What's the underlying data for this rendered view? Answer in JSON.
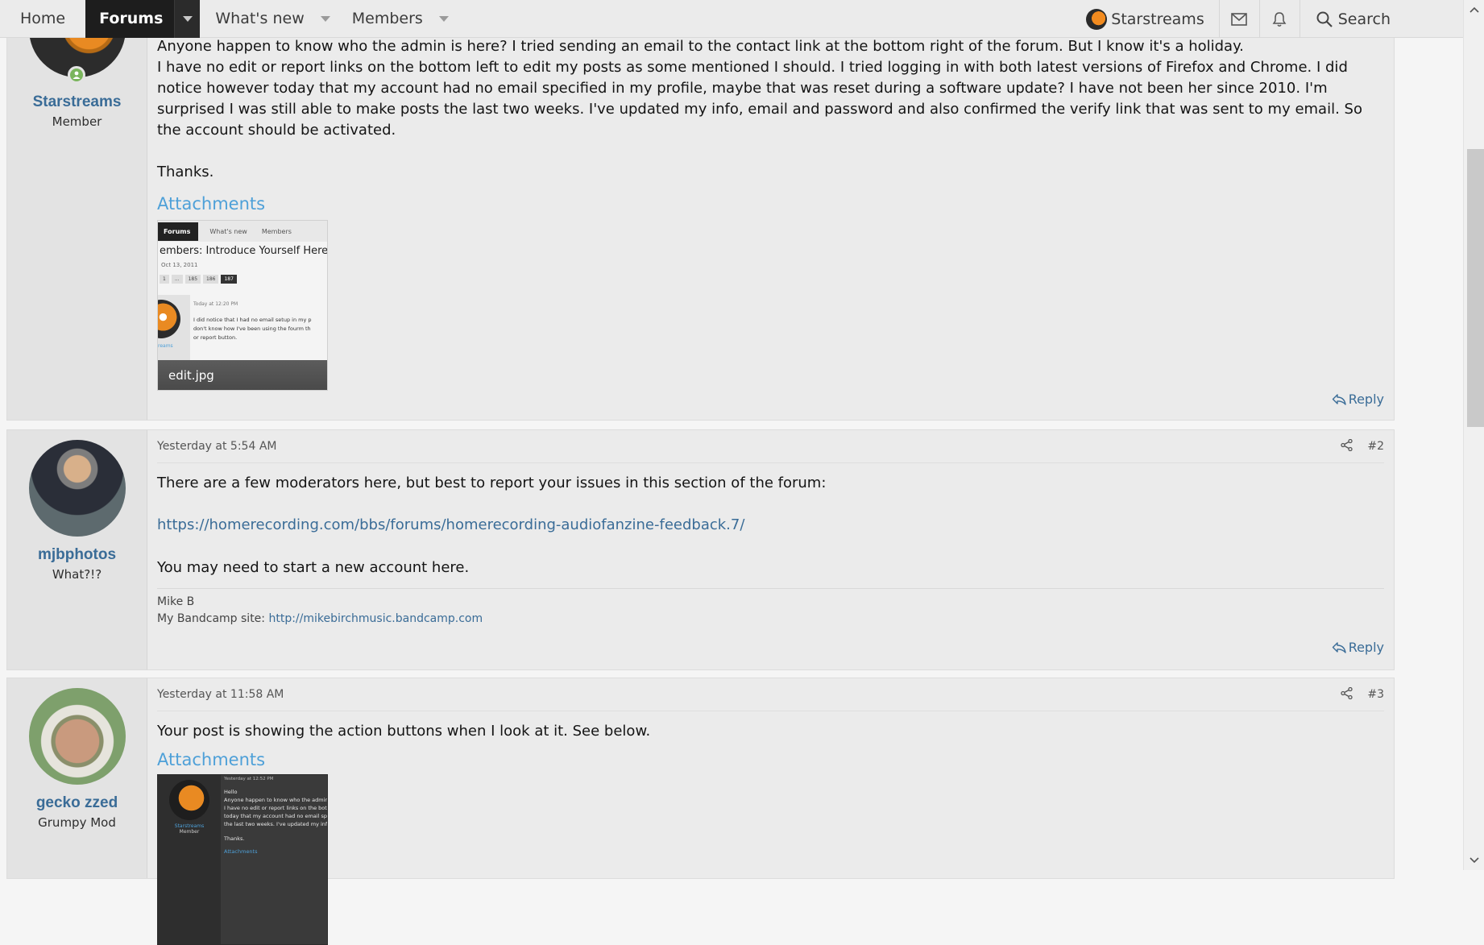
{
  "nav": {
    "home": "Home",
    "forums": "Forums",
    "whats_new": "What's new",
    "members": "Members",
    "user": "Starstreams",
    "search": "Search"
  },
  "posts": [
    {
      "username": "Starstreams",
      "user_title": "Member",
      "online": true,
      "paragraphs": [
        "Anyone happen to know who the admin is here? I tried sending an email to the contact link at the bottom right of the forum. But I know it's a holiday.",
        "I have no edit or report links on the bottom left to edit my posts as some mentioned I should. I tried logging in with both latest versions of Firefox and Chrome. I did notice however today that my account had no email specified in my profile, maybe that was reset during a software update? I have not been her since 2010. I'm surprised I was still able to make posts the last two weeks. I've updated my info, email and password and also confirmed the verify link that was sent to my email. So the account should be activated.",
        "Thanks."
      ],
      "attachments_title": "Attachments",
      "attachment_name": "edit.jpg",
      "attachment_preview": {
        "tabs": [
          "Forums",
          "What's new",
          "Members"
        ],
        "title": "embers: Introduce Yourself Here!",
        "date": "Oct 13, 2011",
        "pages": [
          "1",
          "...",
          "185",
          "186",
          "187"
        ],
        "time": "Today at 12:20 PM",
        "lines": [
          "I did notice that I had no email setup in my p",
          "don't know how I've been using the fourm th",
          "or report button."
        ],
        "name": "reams"
      },
      "reply": "Reply"
    },
    {
      "time": "Yesterday at 5:54 AM",
      "number": "#2",
      "username": "mjbphotos",
      "user_title": "What?!?",
      "text1": "There are a few moderators here, but best to report your issues in this section of the forum:",
      "link": "https://homerecording.com/bbs/forums/homerecording-audiofanzine-feedback.7/",
      "text2": "You may need to start a new account here.",
      "sig_name": "Mike B",
      "sig_prefix": "My Bandcamp site: ",
      "sig_link": "http://mikebirchmusic.bandcamp.com",
      "reply": "Reply"
    },
    {
      "time": "Yesterday at 11:58 AM",
      "number": "#3",
      "username": "gecko zzed",
      "user_title": "Grumpy Mod",
      "text1": "Your post is showing the action buttons when I look at it. See below.",
      "attachments_title": "Attachments",
      "attachment_preview": {
        "time": "Yesterday at 12:52 PM",
        "lines": [
          "Hello",
          "Anyone happen to know who the admin i",
          "I have no edit or report links on the botto",
          "today that my account had no email spec",
          "the last two weeks. I've updated my info,"
        ],
        "thanks": "Thanks.",
        "attach": "Attachments",
        "name": "Starstreams",
        "title": "Member"
      }
    }
  ]
}
